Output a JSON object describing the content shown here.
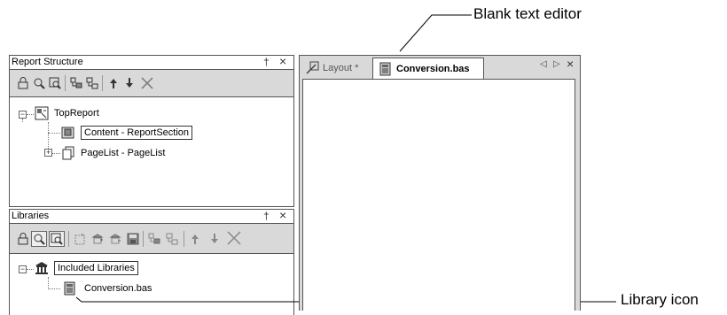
{
  "annotations": {
    "editor_callout": "Blank text editor",
    "library_callout": "Library icon"
  },
  "report_structure": {
    "title": "Report Structure",
    "pin_glyph": "†",
    "close_glyph": "×",
    "toolbar_icons": [
      "lock-icon",
      "zoom-icon",
      "zoom-select-icon",
      "move-out-icon",
      "move-in-icon",
      "move-up-icon",
      "move-down-icon",
      "delete-icon"
    ],
    "tree": {
      "root_label": "TopReport",
      "content_label": "Content - ReportSection",
      "pagelist_label": "PageList - PageList",
      "collapse_glyph": "−",
      "expand_glyph": "+"
    }
  },
  "libraries": {
    "title": "Libraries",
    "pin_glyph": "†",
    "close_glyph": "×",
    "toolbar_icons": [
      "lock-icon",
      "zoom-icon",
      "zoom-select-icon",
      "new-library-icon",
      "add-library-icon",
      "remove-library-icon",
      "save-icon",
      "move-out-icon",
      "move-in-icon",
      "move-up-icon",
      "move-down-icon",
      "delete-icon"
    ],
    "tree": {
      "root_label": "Included Libraries",
      "library_label": "Conversion.bas",
      "collapse_glyph": "−"
    }
  },
  "editor": {
    "tabs": [
      {
        "label": "Layout *",
        "active": false
      },
      {
        "label": "Conversion.bas",
        "active": true
      }
    ],
    "scroll_left_glyph": "◁",
    "scroll_right_glyph": "▷",
    "close_glyph": "×"
  },
  "colors": {
    "toolbar_bg": "#d9d9d9",
    "border": "#555555",
    "callout_line": "#000000"
  }
}
